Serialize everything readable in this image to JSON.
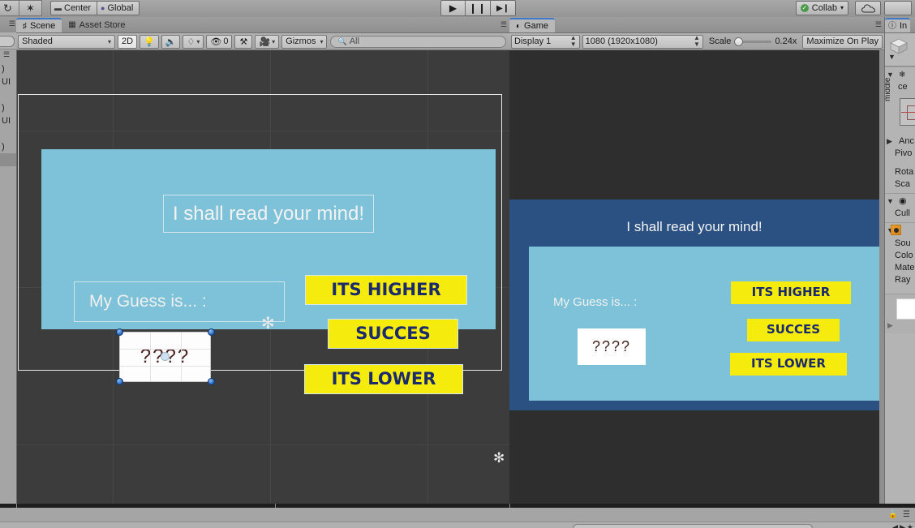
{
  "app": {
    "title": "Unity Editor"
  },
  "main_toolbar": {
    "tools": [
      {
        "name": "rotate-tool",
        "glyph": "↻"
      },
      {
        "name": "scale-tool",
        "glyph": "✶"
      }
    ],
    "pivot_mode": {
      "label": "Center",
      "icon": "pivot-icon"
    },
    "pivot_rotation": {
      "label": "Global",
      "icon": "globe-icon"
    },
    "play_controls": [
      {
        "name": "play-button",
        "glyph": "▶"
      },
      {
        "name": "pause-button",
        "glyph": "❙❙"
      },
      {
        "name": "step-button",
        "glyph": "▶❙"
      }
    ],
    "collab": {
      "label": "Collab",
      "caret": "▾"
    },
    "cloud": {
      "icon": "cloud-icon"
    },
    "account": {
      "icon": "account-icon"
    }
  },
  "hierarchy_sliver": {
    "rows": [
      {
        "label": ")"
      },
      {
        "label": "UI"
      },
      {
        "label": ""
      },
      {
        "label": ")"
      },
      {
        "label": "UI"
      },
      {
        "label": ""
      },
      {
        "label": ")"
      },
      {
        "label": ""
      }
    ]
  },
  "scene_panel": {
    "tabs": [
      {
        "label": "Scene",
        "icon": "grid-icon",
        "active": true
      },
      {
        "label": "Asset Store",
        "icon": "store-icon",
        "active": false
      }
    ],
    "toolbar": {
      "draw_mode": "Shaded",
      "mode_2d": "2D",
      "lighting_icon": "lightbulb-icon",
      "audio_icon": "speaker-icon",
      "effects_icon": "effects-icon",
      "hidden_count": "0",
      "hidden_icon": "eye-off-icon",
      "tools_icon": "tools-icon",
      "camera_icon": "camera-icon",
      "gizmos": "Gizmos",
      "search_placeholder": "All",
      "search_icon": "search-icon",
      "caret": "▾"
    },
    "content": {
      "title_text": "I shall read your mind!",
      "guess_label": "My Guess is... :",
      "input_value": "????",
      "buttons": [
        {
          "label": "ITS HIGHER"
        },
        {
          "label": "SUCCES"
        },
        {
          "label": "ITS LOWER"
        }
      ]
    }
  },
  "game_panel": {
    "tab": {
      "label": "Game",
      "icon": "gamepad-icon"
    },
    "toolbar": {
      "display": "Display 1",
      "resolution": "1080 (1920x1080)",
      "scale_label": "Scale",
      "scale_value": "0.24x",
      "maximize": "Maximize On Play"
    },
    "content": {
      "title_text": "I shall read your mind!",
      "guess_label": "My Guess is... :",
      "input_value": "????",
      "buttons": [
        {
          "label": "ITS HIGHER"
        },
        {
          "label": "SUCCES"
        },
        {
          "label": "ITS LOWER"
        }
      ]
    }
  },
  "inspector": {
    "tab": {
      "label": "In",
      "icon": "info-icon"
    },
    "anchor_preset": {
      "horizontal": "ce",
      "vertical": "middle"
    },
    "rows": [
      {
        "label": "Anc",
        "foldout": "▶"
      },
      {
        "label": "Pivo",
        "foldout": ""
      },
      {
        "label": "",
        "foldout": ""
      },
      {
        "label": "Rota",
        "foldout": ""
      },
      {
        "label": "Sca",
        "foldout": ""
      }
    ],
    "canvas_group": {
      "label": "Cull",
      "foldout": "▼",
      "icon": "eye-icon"
    },
    "image_group": {
      "foldout": "▼",
      "icon": "image-icon",
      "rows": [
        {
          "label": "Sou"
        },
        {
          "label": "Colo"
        },
        {
          "label": "Mate"
        },
        {
          "label": "Ray"
        }
      ]
    },
    "preview_caret": "▶"
  },
  "bottom_bar": {
    "lock_icon": "lock-icon",
    "menu_icon": "menu-icon",
    "nav_icons": [
      "◀",
      "▶",
      "★"
    ]
  },
  "colors": {
    "accent_blue": "#3f78c4",
    "panel_cyan": "#7dc2d8",
    "game_bg_blue": "#2b5183",
    "button_yellow": "#f5ec0d",
    "button_text_navy": "#1b2a6b",
    "chrome_gray": "#a5a5a5",
    "scene_bg": "#3c3c3c"
  }
}
